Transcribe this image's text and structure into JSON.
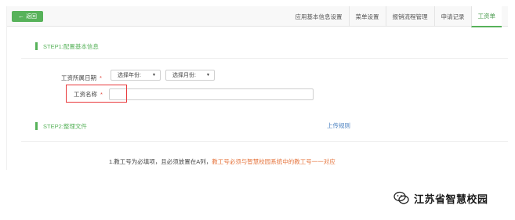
{
  "header": {
    "back_label": "返回",
    "tabs": [
      {
        "label": "应用基本信息设置",
        "active": false
      },
      {
        "label": "菜单设置",
        "active": false
      },
      {
        "label": "报销流程管理",
        "active": false
      },
      {
        "label": "申请记录",
        "active": false
      },
      {
        "label": "工资单",
        "active": true
      }
    ]
  },
  "step1": {
    "title": "STEP1:配置基本信息",
    "period_label": "工资所属日期",
    "year_select": {
      "value": "选择年份:"
    },
    "month_select": {
      "value": "选择月份:"
    },
    "name_label": "工资名称",
    "name_input": {
      "value": ""
    },
    "required_mark": "*"
  },
  "step2": {
    "title": "STEP2:整理文件",
    "upload_link": "上传规则",
    "note_prefix": "1.教工号为必填项，且必须放置在A列，",
    "note_warning": "教工号必须与智慧校园系统中的教工号一一对应"
  },
  "watermark": {
    "text": "江苏省智慧校园"
  },
  "colors": {
    "accent": "#57b25a",
    "required": "#e0463b",
    "warning": "#e5733b",
    "link": "#4a80c0",
    "highlight": "#e8393b"
  }
}
